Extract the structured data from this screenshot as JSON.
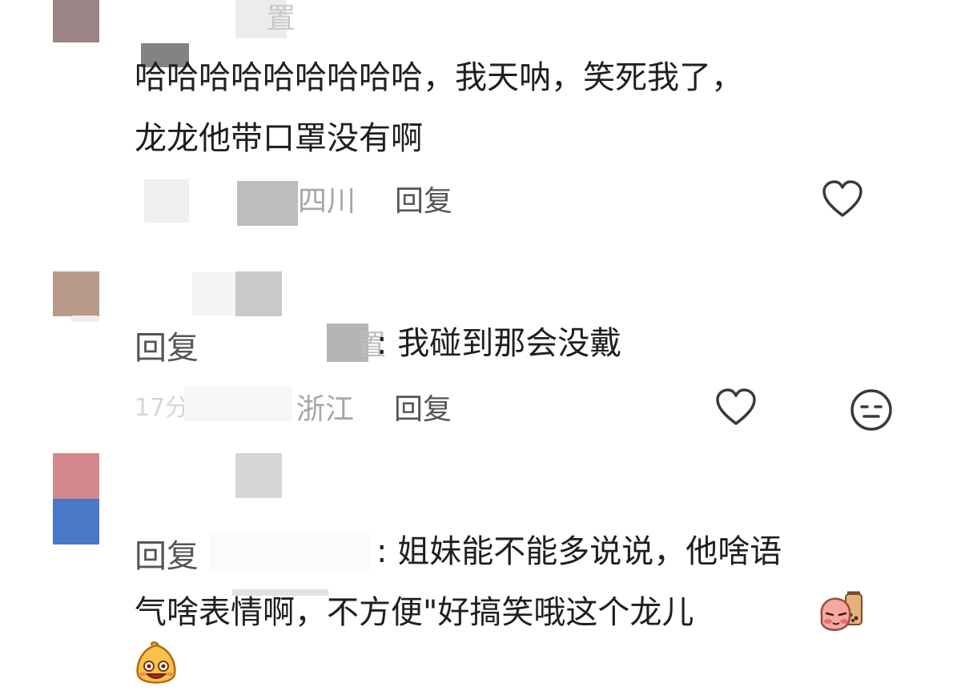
{
  "comments": [
    {
      "name_tail": "置",
      "text_lines": [
        "哈哈哈哈哈哈哈哈哈，我天呐，笑死我了，",
        "龙龙他带口罩没有啊"
      ],
      "location": "四川",
      "reply_label": "回复"
    },
    {
      "reply_prefix": "回复",
      "target_tail": "置",
      "text": ": 我碰到那会没戴",
      "time_fragment": "17分",
      "location": "浙江",
      "reply_label": "回复"
    },
    {
      "reply_prefix": "回复",
      "text_lines": [
        ": 姐妹能不能多说说，他啥语",
        "气啥表情啊，不方便\"好搞笑哦这个龙儿"
      ]
    }
  ],
  "icons": {
    "like": "heart-outline-icon",
    "dislike": "speechless-face-icon",
    "sticker_blush": "blush-peach-sticker",
    "sticker_grin": "grin-pear-sticker"
  },
  "colors": {
    "text": "#1f1f1f",
    "meta": "#a6a6a6",
    "icon": "#3a3a3a",
    "avatar1": "#9b8486",
    "avatar2": "#b8998a",
    "avatar3_top": "#d4878d",
    "avatar3_bottom": "#4a77c8"
  }
}
